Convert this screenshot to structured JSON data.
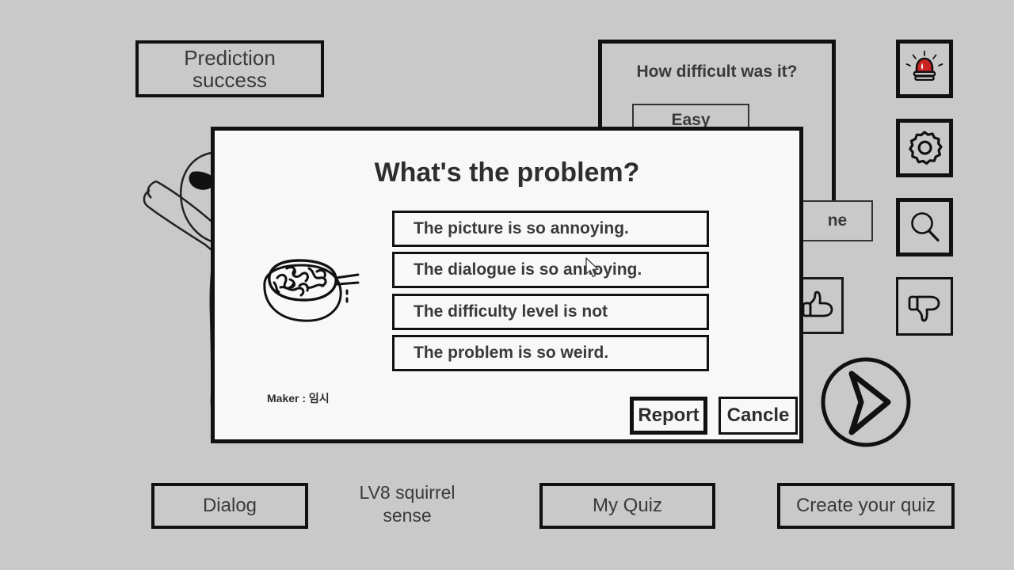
{
  "theme": {
    "background": "#c9c9c9",
    "outline": "#111111",
    "text": "#3a3a3a",
    "modal_bg": "#f8f8f8",
    "alarm_red": "#cc2222"
  },
  "background_screen": {
    "prediction_button": {
      "line1": "Prediction",
      "line2": "success"
    },
    "difficulty_panel": {
      "title": "How difficult was it?",
      "options": [
        {
          "label": "Easy"
        },
        {
          "label": "ne"
        }
      ]
    },
    "sidebar_icons": [
      {
        "name": "alarm-icon",
        "glyph": "siren"
      },
      {
        "name": "gear-icon",
        "glyph": "gear"
      },
      {
        "name": "search-icon",
        "glyph": "magnifier"
      },
      {
        "name": "thumbs-down-icon",
        "glyph": "thumb-down"
      }
    ],
    "thumbs_up_icon": {
      "name": "thumbs-up-icon",
      "glyph": "thumb-up"
    },
    "next_arrow": {
      "name": "next-arrow-button",
      "glyph": "arrow-right"
    },
    "bottom_bar": {
      "dialog_button": "Dialog",
      "level_label": {
        "line1": "LV8 squirrel",
        "line2": "sense"
      },
      "my_quiz_button": "My Quiz",
      "create_quiz_button": "Create your quiz"
    }
  },
  "modal": {
    "title": "What's the problem?",
    "options": [
      "The picture is so annoying.",
      "The dialogue is so annoying.",
      "The difficulty level is not",
      "The problem is so weird."
    ],
    "maker_line": "Maker : 임시",
    "report_button": "Report",
    "cancel_button": "Cancle"
  }
}
